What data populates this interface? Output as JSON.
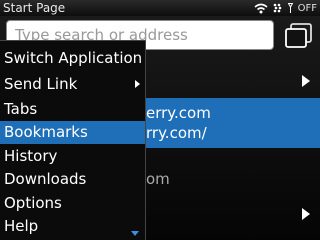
{
  "status_bar": {
    "title": "Start Page",
    "radio_status": "OFF"
  },
  "address_bar": {
    "placeholder": "Type search or address"
  },
  "background": {
    "selected_line1": "erry.com",
    "selected_line2": "rry.com/",
    "dim_text": "om"
  },
  "menu": {
    "items": [
      {
        "label": "Switch Application"
      },
      {
        "label": "Send Link"
      },
      {
        "label": "Tabs"
      },
      {
        "label": "Bookmarks"
      },
      {
        "label": "History"
      },
      {
        "label": "Downloads"
      },
      {
        "label": "Options"
      },
      {
        "label": "Help"
      }
    ],
    "selected_index": 3
  },
  "colors": {
    "highlight": "#1e6fb8"
  }
}
